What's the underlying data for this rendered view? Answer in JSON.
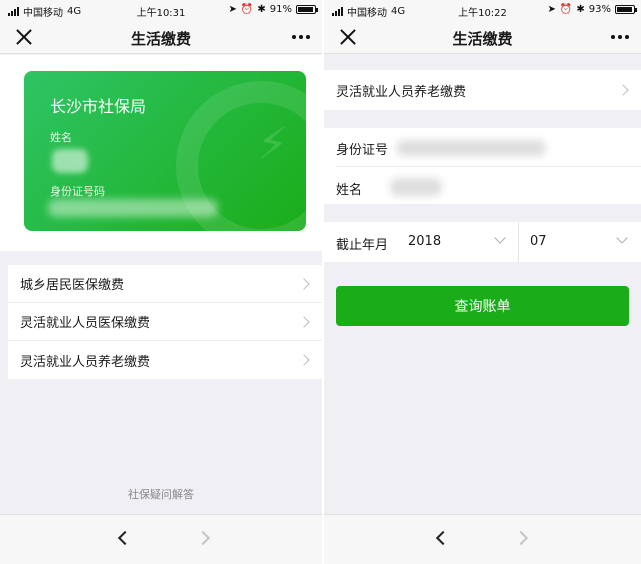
{
  "left": {
    "status": {
      "carrier": "中国移动",
      "network": "4G",
      "time": "上午10:31",
      "battery": "91%",
      "battery_level": 0.91
    },
    "nav": {
      "title": "生活缴费"
    },
    "card": {
      "org": "长沙市社保局",
      "name_label": "姓名",
      "id_label": "身份证号码"
    },
    "list": [
      {
        "label": "城乡居民医保缴费"
      },
      {
        "label": "灵活就业人员医保缴费"
      },
      {
        "label": "灵活就业人员养老缴费"
      }
    ],
    "faq_link": "社保疑问解答"
  },
  "right": {
    "status": {
      "carrier": "中国移动",
      "network": "4G",
      "time": "上午10:22",
      "battery": "93%",
      "battery_level": 0.93
    },
    "nav": {
      "title": "生活缴费"
    },
    "type_row": {
      "label": "灵活就业人员养老缴费"
    },
    "info": {
      "id_label": "身份证号",
      "name_label": "姓名"
    },
    "date": {
      "label": "截止年月",
      "year": "2018",
      "month": "07"
    },
    "query_button": "查询账单"
  },
  "colors": {
    "accent": "#1aad19",
    "card_green": "#2fc465",
    "background": "#efeff4"
  },
  "icons": [
    "close-icon",
    "more-icon",
    "chevron-right-icon",
    "chevron-down-icon",
    "back-arrow-icon",
    "forward-arrow-icon",
    "signal-icon",
    "battery-icon",
    "alarm-icon",
    "location-icon",
    "bluetooth-icon"
  ]
}
